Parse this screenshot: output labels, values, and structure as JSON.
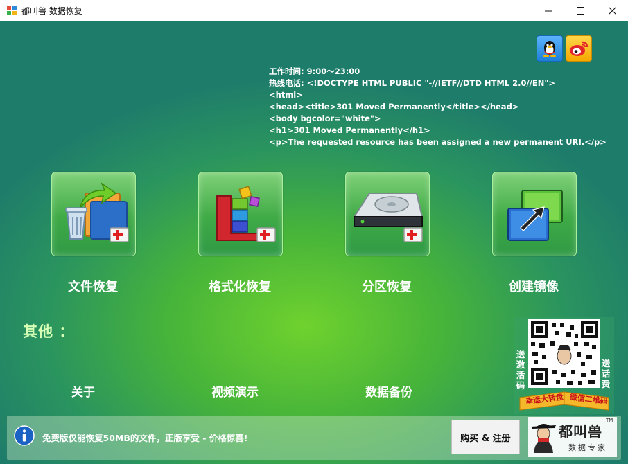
{
  "window": {
    "title": "都叫兽 数据恢复"
  },
  "info": {
    "line1": "工作时间: 9:00～23:00",
    "line2": "热线电话: <!DOCTYPE HTML PUBLIC \"-//IETF//DTD HTML 2.0//EN\">",
    "line3": "<html>",
    "line4": "<head><title>301 Moved Permanently</title></head>",
    "line5": "<body bgcolor=\"white\">",
    "line6": "<h1>301 Moved Permanently</h1>",
    "line7": "<p>The requested resource has been assigned a new permanent URI.</p>"
  },
  "social": [
    {
      "icon": "qq-penguin-icon"
    },
    {
      "icon": "weibo-icon"
    }
  ],
  "tiles": [
    {
      "label": "文件恢复",
      "icon": "file-recovery-icon"
    },
    {
      "label": "格式化恢复",
      "icon": "format-recovery-icon"
    },
    {
      "label": "分区恢复",
      "icon": "partition-recovery-icon"
    },
    {
      "label": "创建镜像",
      "icon": "create-image-icon"
    }
  ],
  "other": {
    "label": "其他 ：",
    "links": [
      "关于",
      "视频演示",
      "数据备份"
    ]
  },
  "qr": {
    "left_text": "送激活码",
    "right_text": "送话费",
    "ribbon_left": "幸运大转盘",
    "ribbon_right": "微信二维码"
  },
  "status": {
    "notice": "免费版仅能恢复50MB的文件，正版享受 - 价格惊喜!",
    "buy_label": "购买 & 注册"
  },
  "brand": {
    "name": "都叫兽",
    "tm": "TM",
    "subtitle": "数据专家"
  },
  "colors": {
    "accent_green": "#47b43a",
    "dark_teal": "#1e7c6a",
    "label_light_green": "#d7ffb5"
  }
}
